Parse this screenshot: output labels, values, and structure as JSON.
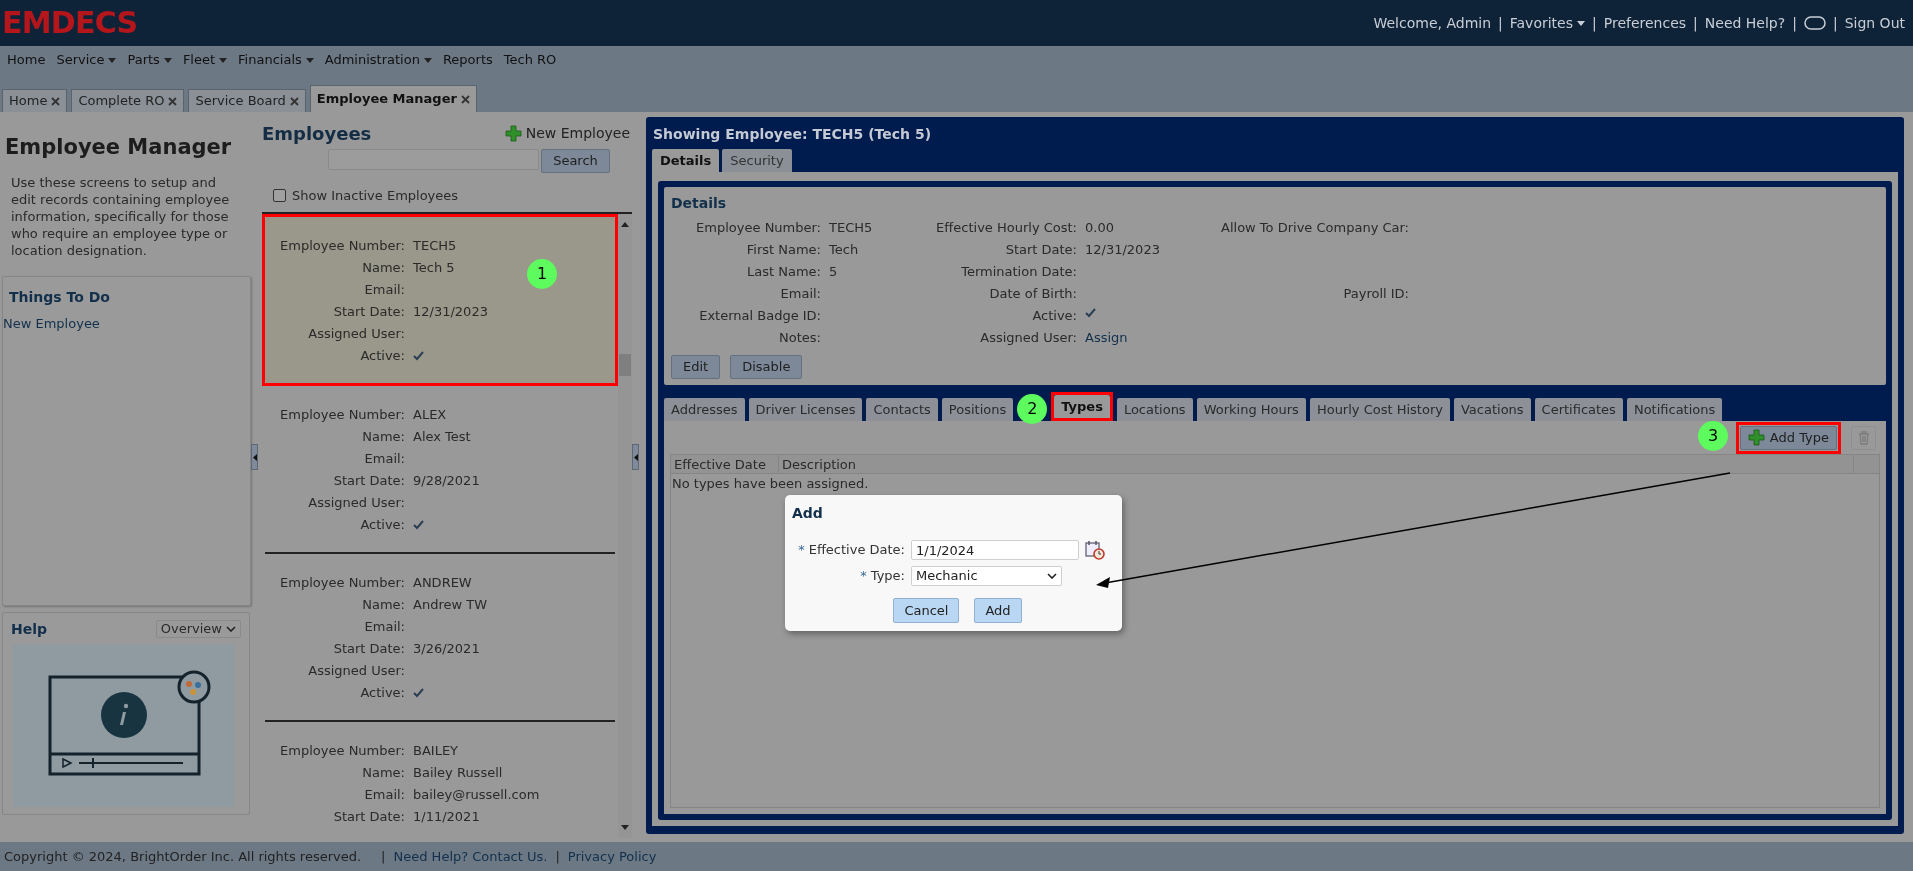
{
  "header": {
    "logo": "EMDECS",
    "user_links": [
      {
        "kind": "text",
        "label": "Welcome, Admin"
      },
      {
        "kind": "separator",
        "label": "|"
      },
      {
        "kind": "menu",
        "label": "Favorites"
      },
      {
        "kind": "separator",
        "label": "|"
      },
      {
        "kind": "link",
        "label": "Preferences"
      },
      {
        "kind": "separator",
        "label": "|"
      },
      {
        "kind": "link",
        "label": "Need Help?"
      },
      {
        "kind": "separator",
        "label": "|"
      },
      {
        "kind": "icon"
      },
      {
        "kind": "separator",
        "label": "|"
      },
      {
        "kind": "link",
        "label": "Sign Out"
      }
    ]
  },
  "menu": [
    {
      "label": "Home",
      "dropdown": false
    },
    {
      "label": "Service",
      "dropdown": true
    },
    {
      "label": "Parts",
      "dropdown": true
    },
    {
      "label": "Fleet",
      "dropdown": true
    },
    {
      "label": "Financials",
      "dropdown": true
    },
    {
      "label": "Administration",
      "dropdown": true
    },
    {
      "label": "Reports",
      "dropdown": false
    },
    {
      "label": "Tech RO",
      "dropdown": false
    }
  ],
  "tabs": [
    {
      "label": "Home",
      "selected": false
    },
    {
      "label": "Complete RO",
      "selected": false
    },
    {
      "label": "Service Board",
      "selected": false
    },
    {
      "label": "Employee Manager",
      "selected": true
    }
  ],
  "sidebar": {
    "title": "Employee Manager",
    "description": "Use these screens to setup and edit records containing employee information, specifically for those who require an employee type or location designation.",
    "things_to_do": {
      "title": "Things To Do",
      "links": [
        "New Employee"
      ]
    },
    "help": {
      "title": "Help",
      "dropdown": "Overview"
    }
  },
  "employees": {
    "title": "Employees",
    "new_button": "New Employee",
    "search_button": "Search",
    "show_inactive": {
      "label": "Show Inactive Employees",
      "checked": false
    },
    "list": [
      {
        "selected": true,
        "highlighted": true,
        "annotation": "1",
        "fields": [
          {
            "label": "Employee Number:",
            "value": "TECH5"
          },
          {
            "label": "Name:",
            "value": "Tech 5"
          },
          {
            "label": "Email:"
          },
          {
            "label": "Start Date:",
            "value": "12/31/2023"
          },
          {
            "label": "Assigned User:"
          },
          {
            "label": "Active:",
            "checked": true
          }
        ]
      },
      {
        "selected": false,
        "highlighted": false,
        "fields": [
          {
            "label": "Employee Number:",
            "value": "ALEX"
          },
          {
            "label": "Name:",
            "value": "Alex Test"
          },
          {
            "label": "Email:"
          },
          {
            "label": "Start Date:",
            "value": "9/28/2021"
          },
          {
            "label": "Assigned User:"
          },
          {
            "label": "Active:",
            "checked": true
          }
        ]
      },
      {
        "selected": false,
        "highlighted": false,
        "fields": [
          {
            "label": "Employee Number:",
            "value": "ANDREW"
          },
          {
            "label": "Name:",
            "value": "Andrew TW"
          },
          {
            "label": "Email:"
          },
          {
            "label": "Start Date:",
            "value": "3/26/2021"
          },
          {
            "label": "Assigned User:"
          },
          {
            "label": "Active:",
            "checked": true
          }
        ]
      },
      {
        "selected": false,
        "highlighted": false,
        "fields": [
          {
            "label": "Employee Number:",
            "value": "BAILEY"
          },
          {
            "label": "Name:",
            "value": "Bailey Russell"
          },
          {
            "label": "Email:",
            "value": "bailey@russell.com"
          },
          {
            "label": "Start Date:",
            "value": "1/11/2021"
          }
        ]
      }
    ]
  },
  "detail": {
    "title": "Showing Employee: TECH5 (Tech 5)",
    "tabs": [
      {
        "label": "Details",
        "selected": true
      },
      {
        "label": "Security",
        "selected": false
      }
    ],
    "section_title": "Details",
    "columns": [
      [
        {
          "label": "Employee Number:",
          "value": "TECH5"
        },
        {
          "label": "First Name:",
          "value": "Tech"
        },
        {
          "label": "Last Name:",
          "value": "5"
        },
        {
          "label": "Email:"
        },
        {
          "label": "External Badge ID:"
        },
        {
          "label": "Notes:"
        }
      ],
      [
        {
          "label": "Effective Hourly Cost:",
          "value": "0.00"
        },
        {
          "label": "Start Date:",
          "value": "12/31/2023"
        },
        {
          "label": "Termination Date:"
        },
        {
          "label": "Date of Birth:"
        },
        {
          "label": "Active:",
          "checked": true
        },
        {
          "label": "Assigned User:",
          "link": "Assign"
        }
      ],
      [
        {
          "label": "Allow To Drive Company Car:"
        },
        {
          "label": "Payroll ID:"
        }
      ]
    ],
    "buttons": [
      "Edit",
      "Disable"
    ],
    "subtabs": [
      {
        "label": "Addresses",
        "selected": false
      },
      {
        "label": "Driver Licenses",
        "selected": false
      },
      {
        "label": "Contacts",
        "selected": false
      },
      {
        "label": "Positions",
        "selected": false
      },
      {
        "label": "Types",
        "selected": true,
        "highlighted": true,
        "annotation": "2"
      },
      {
        "label": "Locations",
        "selected": false
      },
      {
        "label": "Working Hours",
        "selected": false
      },
      {
        "label": "Hourly Cost History",
        "selected": false
      },
      {
        "label": "Vacations",
        "selected": false
      },
      {
        "label": "Certificates",
        "selected": false
      },
      {
        "label": "Notifications",
        "selected": false
      }
    ],
    "add_button": {
      "label": "Add Type",
      "highlighted": true,
      "annotation": "3"
    },
    "delete_button": {
      "disabled": true
    },
    "table": {
      "columns": [
        "Effective Date",
        "Description"
      ],
      "empty_message": "No types have been assigned."
    }
  },
  "dialog": {
    "title": "Add",
    "fields": [
      {
        "kind": "date",
        "label": "Effective Date:",
        "required": true,
        "value": "1/1/2024"
      },
      {
        "kind": "select",
        "label": "Type:",
        "required": true,
        "value": "Mechanic"
      }
    ],
    "required_mark": "*",
    "buttons": [
      "Cancel",
      "Add"
    ]
  },
  "footer": {
    "copyright": "Copyright © 2024, BrightOrder Inc. All rights reserved.",
    "items": [
      {
        "kind": "separator",
        "label": "|"
      },
      {
        "kind": "link",
        "label": "Need Help? Contact Us."
      },
      {
        "kind": "separator",
        "label": "|"
      },
      {
        "kind": "link",
        "label": "Privacy Policy"
      }
    ]
  }
}
